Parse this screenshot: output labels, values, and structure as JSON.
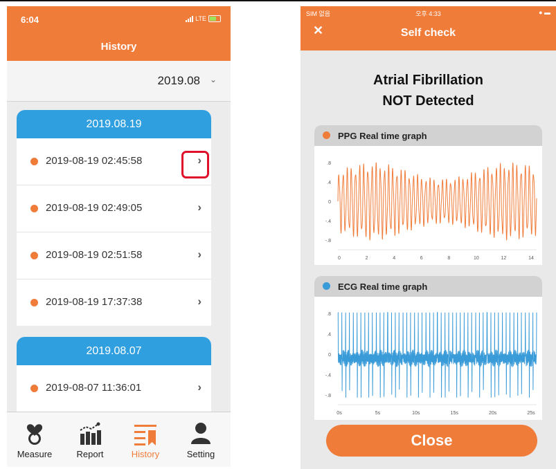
{
  "left": {
    "status": {
      "time": "6:04",
      "network": "LTE"
    },
    "header": {
      "title": "History"
    },
    "month_selector": {
      "value": "2019.08",
      "chevron": "chevron-down-icon"
    },
    "days": [
      {
        "date": "2019.08.19",
        "items": [
          "2019-08-19 02:45:58",
          "2019-08-19 02:49:05",
          "2019-08-19 02:51:58",
          "2019-08-19 17:37:38"
        ]
      },
      {
        "date": "2019.08.07",
        "items": [
          "2019-08-07 11:36:01"
        ]
      }
    ],
    "tabs": [
      {
        "label": "Measure",
        "icon": "heart-stethoscope-icon"
      },
      {
        "label": "Report",
        "icon": "bar-chart-icon"
      },
      {
        "label": "History",
        "icon": "history-list-icon",
        "active": true
      },
      {
        "label": "Setting",
        "icon": "person-icon"
      }
    ],
    "colors": {
      "accent": "#f07c3a",
      "day_header": "#2f9fe0",
      "highlight": "#e0102a"
    }
  },
  "right": {
    "status": {
      "left": "SIM 없음",
      "center": "오후 4:33"
    },
    "header": {
      "title": "Self check",
      "close_icon": "close-icon"
    },
    "result": {
      "line1": "Atrial Fibrillation",
      "line2": "NOT Detected"
    },
    "ppg": {
      "title": "PPG Real time graph",
      "color": "#f07c3a",
      "yticks": [
        ".8",
        ".4",
        "0",
        "-.4",
        "-.8"
      ],
      "xticks": [
        "0",
        "2",
        "4",
        "6",
        "8",
        "10",
        "12",
        "14"
      ]
    },
    "ecg": {
      "title": "ECG Real time graph",
      "color": "#3a9bd9",
      "yticks": [
        ".8",
        ".4",
        "0",
        "-.4",
        "-.8"
      ],
      "xticks": [
        "0s",
        "5s",
        "10s",
        "15s",
        "20s",
        "25s"
      ]
    },
    "close_button": "Close"
  }
}
